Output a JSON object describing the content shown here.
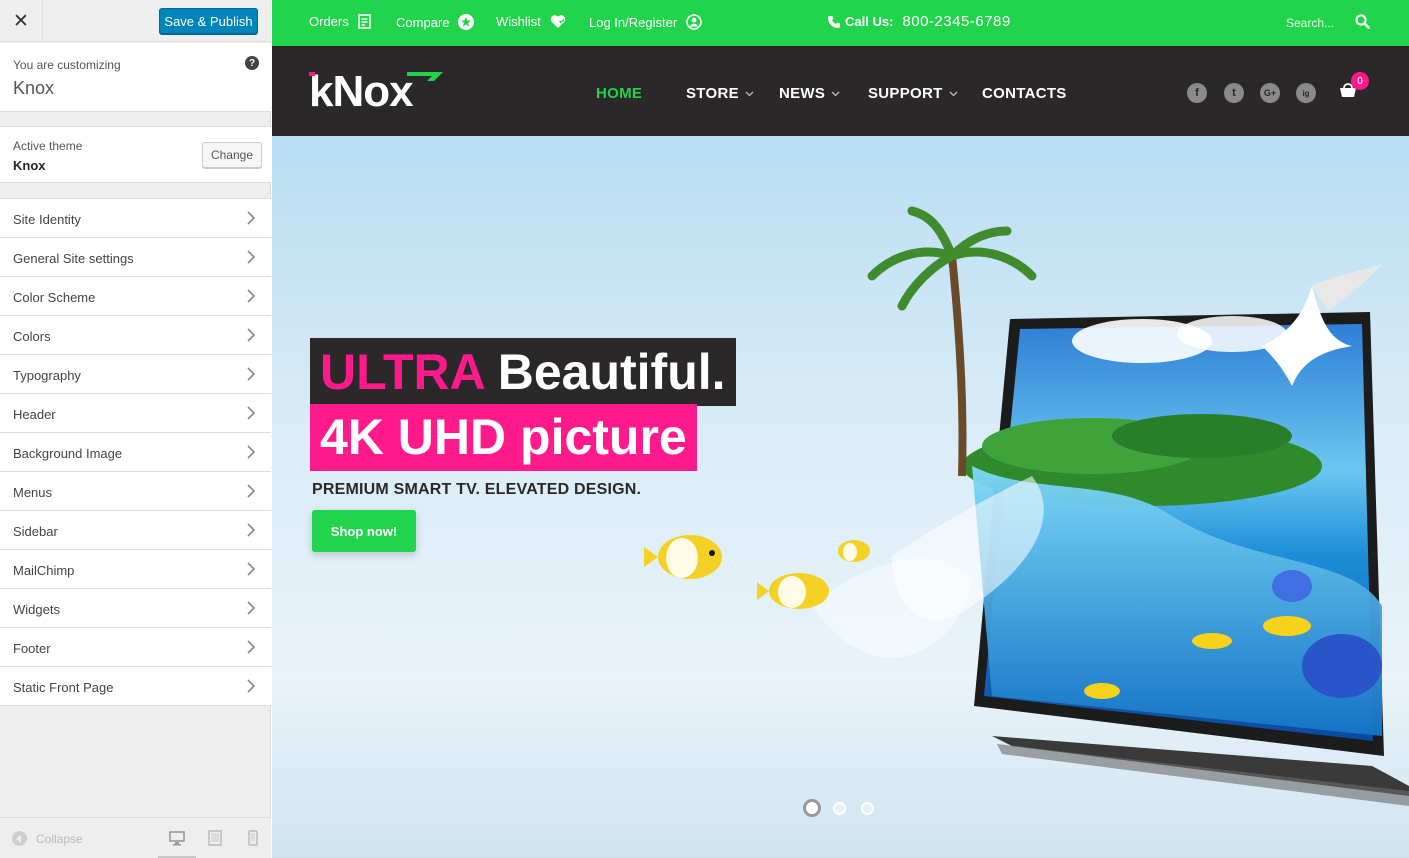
{
  "sidebar": {
    "close_glyph": "✕",
    "save_label": "Save & Publish",
    "customizing_label": "You are customizing",
    "customizing_name": "Knox",
    "help_glyph": "?",
    "active_theme_label": "Active theme",
    "active_theme_name": "Knox",
    "change_label": "Change",
    "sections": [
      "Site Identity",
      "General Site settings",
      "Color Scheme",
      "Colors",
      "Typography",
      "Header",
      "Background Image",
      "Menus",
      "Sidebar",
      "MailChimp",
      "Widgets",
      "Footer",
      "Static Front Page"
    ],
    "collapse_label": "Collapse"
  },
  "topbar": {
    "orders": "Orders",
    "compare": "Compare",
    "wishlist": "Wishlist",
    "login": "Log In/Register",
    "call_label": "Call Us:",
    "phone": "800-2345-6789",
    "search_placeholder": "Search..."
  },
  "nav": {
    "logo": "kNox",
    "items": [
      "HOME",
      "STORE",
      "NEWS",
      "SUPPORT",
      "CONTACTS"
    ],
    "social": [
      "f",
      "t",
      "G+",
      "ig"
    ],
    "cart_count": "0"
  },
  "hero": {
    "line1_accent": "ULTRA",
    "line1_rest": " Beautiful.",
    "line2": "4K UHD picture",
    "subtitle": "PREMIUM SMART TV. ELEVATED DESIGN.",
    "cta": "Shop now!",
    "slides": 3,
    "active_slide": 1
  },
  "colors": {
    "accent_green": "#22d34c",
    "accent_pink": "#ff1a8c",
    "dark": "#2a2829",
    "wp_blue": "#0085ba"
  }
}
